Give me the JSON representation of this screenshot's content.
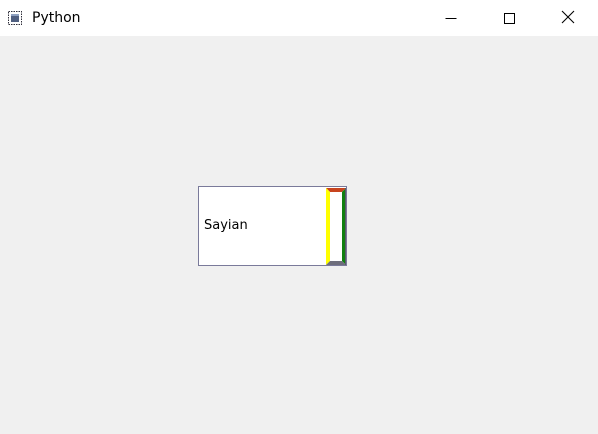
{
  "window": {
    "title": "Python",
    "icons": {
      "app": "app-window-icon",
      "minimize": "minimize-icon",
      "maximize": "maximize-icon",
      "close": "close-icon"
    }
  },
  "combo_box": {
    "value": "Sayian",
    "button_icon": "dropdown-button-icon",
    "colors": {
      "background": "#ffffff",
      "border": "#7a7a9a",
      "button_top": "#c8441e",
      "button_left": "#ffff00",
      "button_right": "#118011",
      "button_bottom": "#6e6e7c"
    }
  },
  "colors": {
    "titlebar": "#ffffff",
    "client_background": "#f0f0f0"
  }
}
